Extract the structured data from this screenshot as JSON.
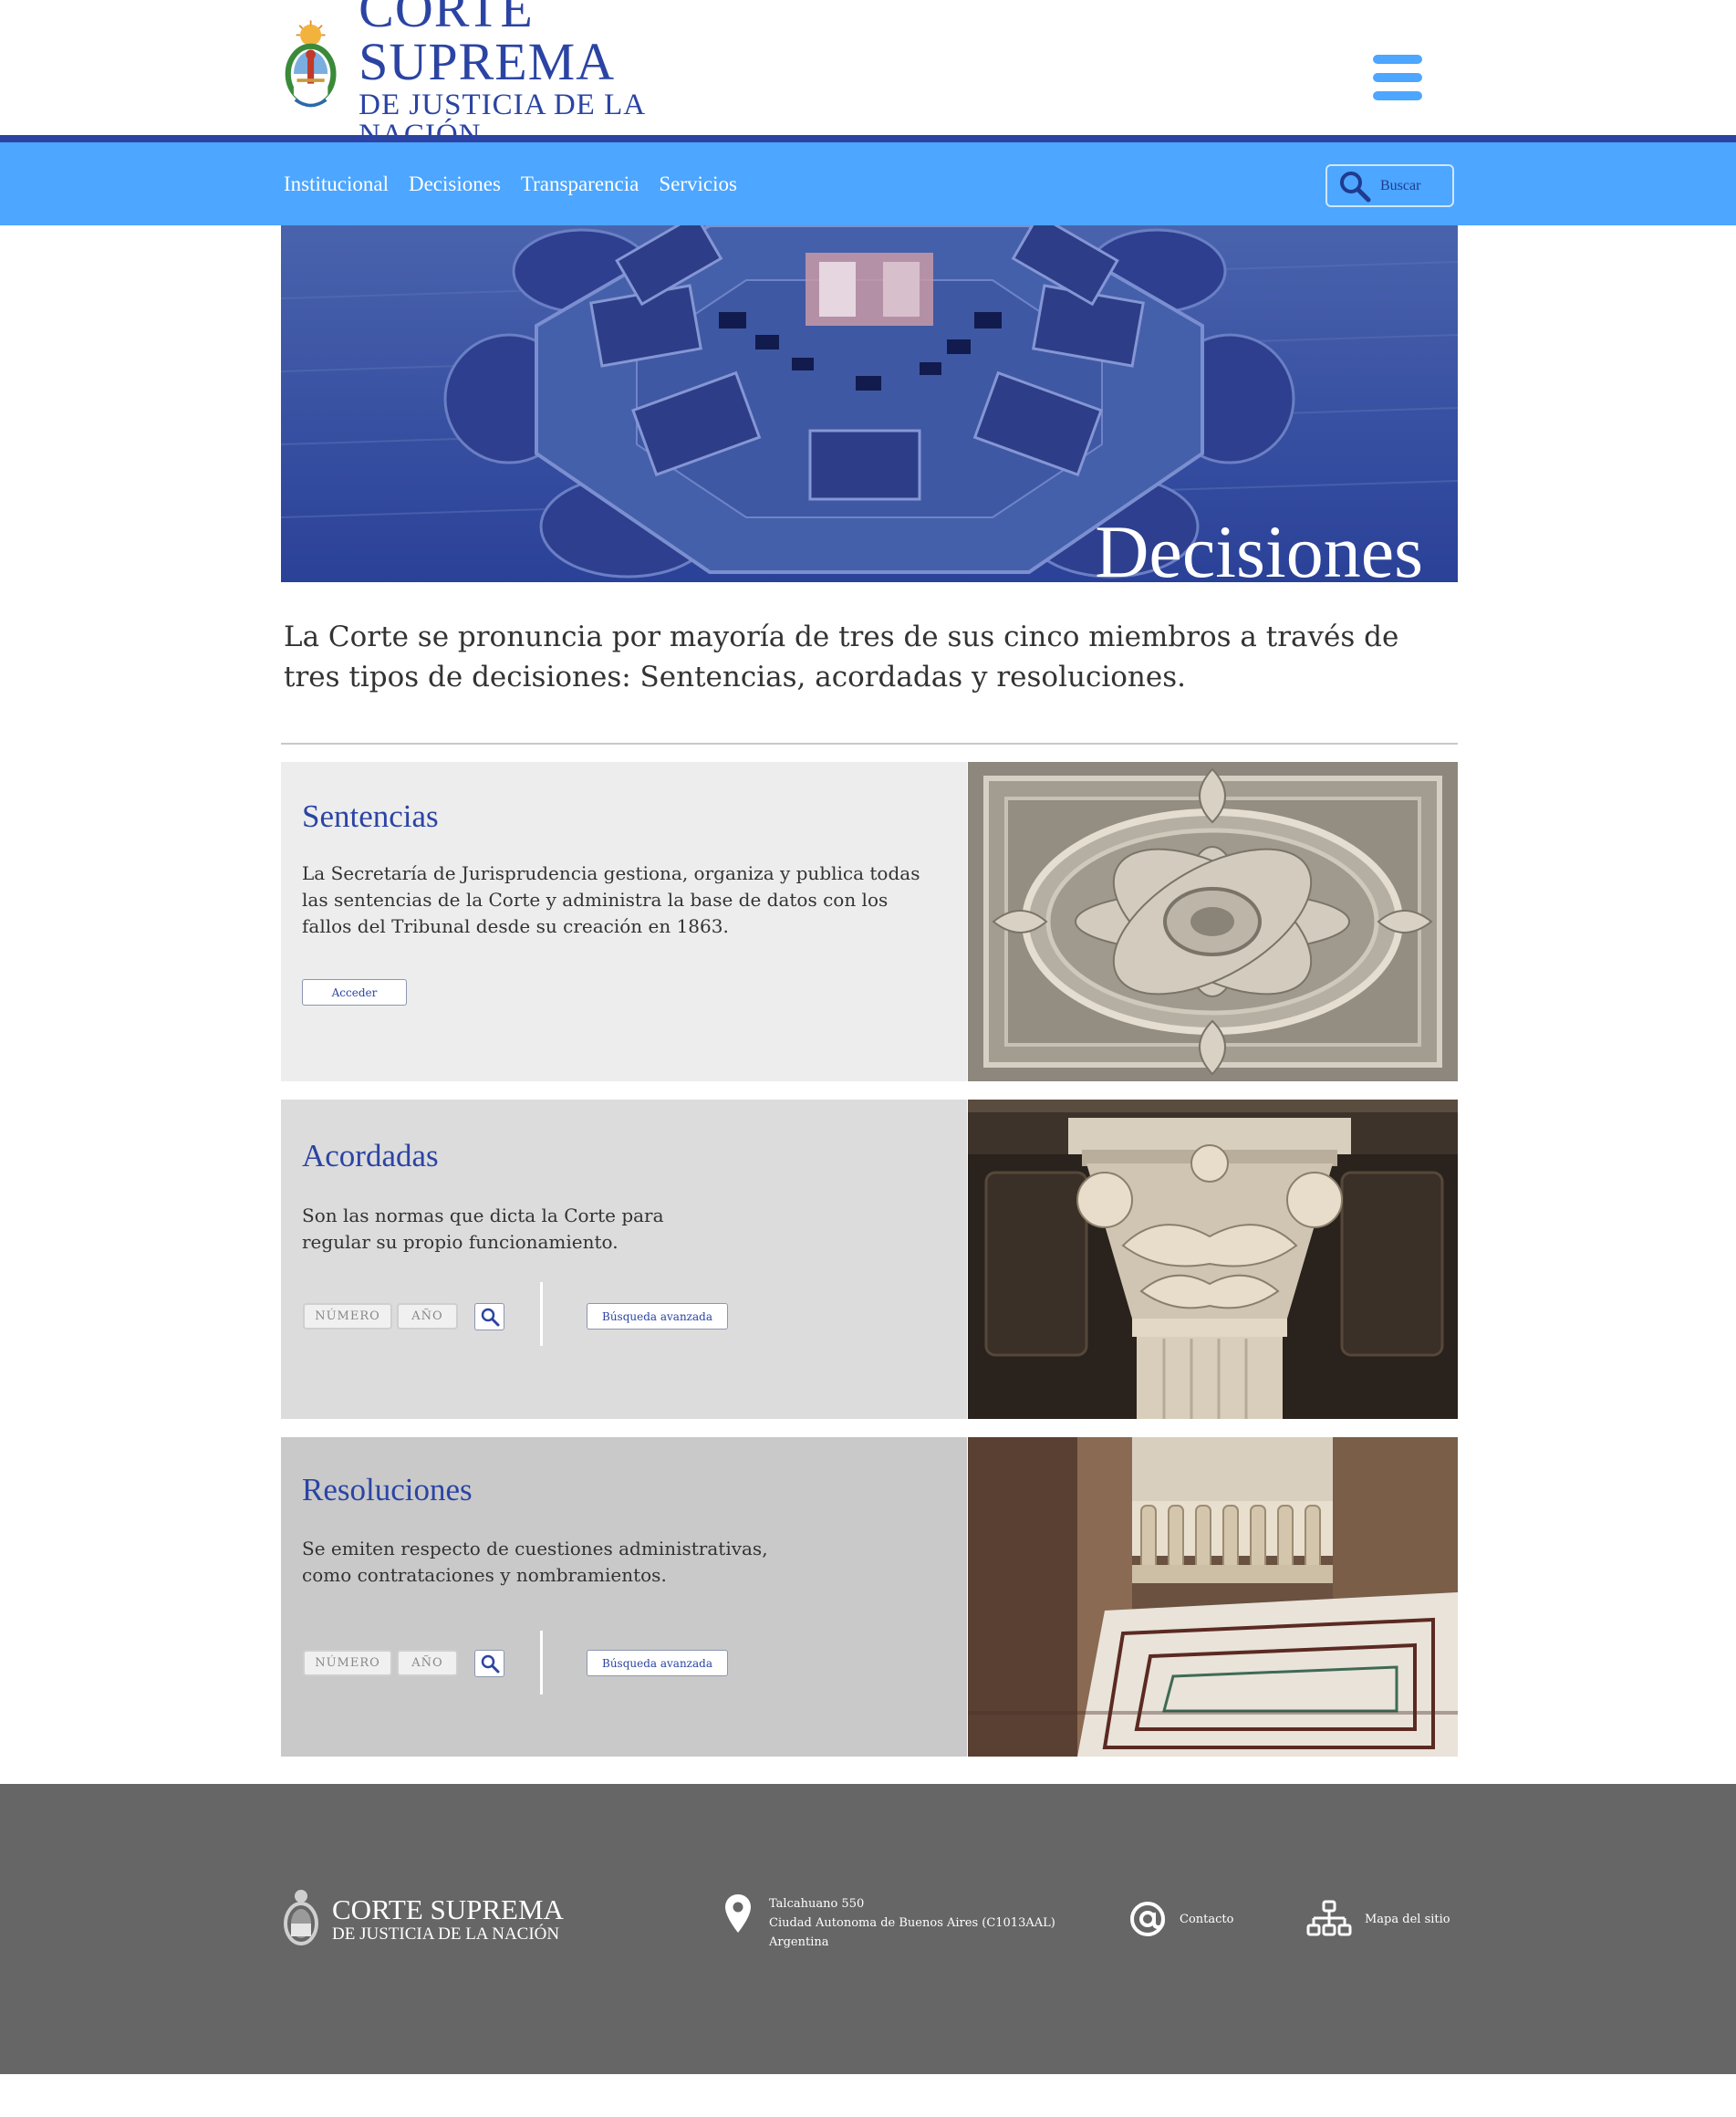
{
  "header": {
    "logo_line1": "CORTE SUPREMA",
    "logo_line2": "DE JUSTICIA DE LA NACIÓN"
  },
  "nav": {
    "items": [
      "Institucional",
      "Decisiones",
      "Transparencia",
      "Servicios"
    ],
    "search_label": "Buscar"
  },
  "hero": {
    "title": "Decisiones"
  },
  "intro": "La Corte se pronuncia por mayoría de tres de sus cinco miembros a través de tres tipos de decisiones: Sentencias, acordadas y resoluciones.",
  "cards": [
    {
      "title": "Sentencias",
      "description": "La Secretaría de Jurisprudencia gestiona, organiza y publica todas las sentencias de la Corte y administra la base de datos con los fallos del Tribunal desde su creación en 1863.",
      "button": "Acceder",
      "bg": "#ededed"
    },
    {
      "title": "Acordadas",
      "description": "Son las normas que dicta la Corte para regular su propio funcionamiento.",
      "numero_placeholder": "NÚMERO",
      "anio_placeholder": "AÑO",
      "advanced": "Búsqueda avanzada",
      "bg": "#dcdcdc"
    },
    {
      "title": "Resoluciones",
      "description": "Se emiten respecto de cuestiones administrativas, como contrataciones y nombramientos.",
      "numero_placeholder": "NÚMERO",
      "anio_placeholder": "AÑO",
      "advanced": "Búsqueda avanzada",
      "bg": "#c9c9c9"
    }
  ],
  "footer": {
    "logo_line1": "CORTE SUPREMA",
    "logo_line2": "DE JUSTICIA DE LA NACIÓN",
    "address": [
      "Talcahuano 550",
      "Ciudad Autonoma de Buenos Aires (C1013AAL)",
      "Argentina"
    ],
    "contact": "Contacto",
    "sitemap": "Mapa del sitio"
  },
  "colors": {
    "brand_blue": "#2b44a3",
    "nav_blue": "#4da6ff",
    "footer_gray": "#666666"
  },
  "icons": [
    "argentina-seal-icon",
    "hamburger-menu-icon",
    "search-icon",
    "location-pin-icon",
    "at-sign-icon",
    "sitemap-icon"
  ]
}
